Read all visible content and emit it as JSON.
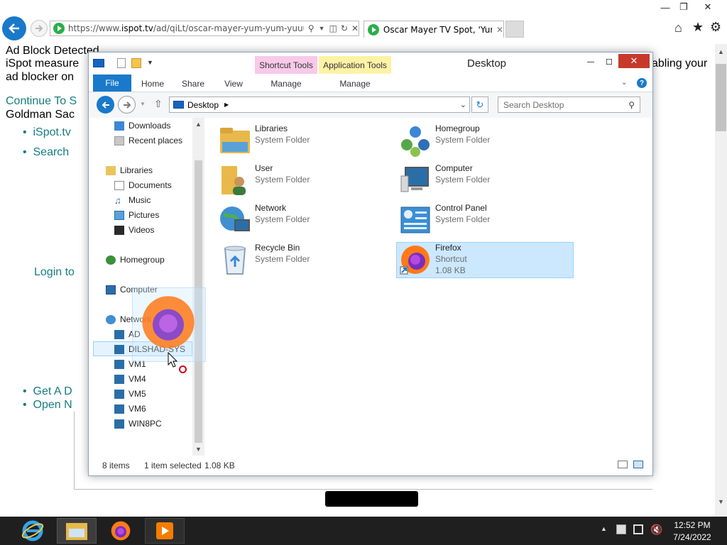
{
  "browser": {
    "url_text": "https://www.",
    "url_host": "ispot.tv",
    "url_path": "/ad/qiLt/oscar-mayer-yum-yum-yuuuum",
    "tab_title": "Oscar Mayer TV Spot, 'Yum...",
    "window_controls": [
      "minimize-icon",
      "restore-icon",
      "close-icon"
    ],
    "toolbar_icons": [
      "home-icon",
      "star-icon",
      "gear-icon"
    ]
  },
  "page": {
    "lines": [
      "Ad Block Detected",
      "iSpot measure",
      "ad blocker on",
      "abling your"
    ],
    "continue_link": "Continue To S",
    "goldman": "Goldman Sac",
    "bullets": [
      "iSpot.tv",
      "Search"
    ],
    "login": "Login to",
    "bottom_bullets": [
      "Get A D",
      "Open N"
    ]
  },
  "explorer": {
    "title": "Desktop",
    "context_tabs": {
      "shortcut": "Shortcut Tools",
      "application": "Application Tools"
    },
    "ribbon_tabs": [
      "File",
      "Home",
      "Share",
      "View",
      "Manage",
      "Manage"
    ],
    "breadcrumb": "Desktop",
    "search_placeholder": "Search Desktop",
    "nav": {
      "favorites": [
        "Downloads",
        "Recent places"
      ],
      "libraries": "Libraries",
      "library_items": [
        "Documents",
        "Music",
        "Pictures",
        "Videos"
      ],
      "homegroup": "Homegroup",
      "computer": "Computer",
      "network": "Network",
      "network_items": [
        "AD",
        "DILSHAD-SYS",
        "VM1",
        "VM4",
        "VM5",
        "VM6",
        "WIN8PC"
      ]
    },
    "items": [
      {
        "name": "Libraries",
        "type": "System Folder",
        "icon": "libraries-icon"
      },
      {
        "name": "Homegroup",
        "type": "System Folder",
        "icon": "homegroup-icon"
      },
      {
        "name": "User",
        "type": "System Folder",
        "icon": "user-folder-icon"
      },
      {
        "name": "Computer",
        "type": "System Folder",
        "icon": "computer-icon"
      },
      {
        "name": "Network",
        "type": "System Folder",
        "icon": "network-icon"
      },
      {
        "name": "Control Panel",
        "type": "System Folder",
        "icon": "control-panel-icon"
      },
      {
        "name": "Recycle Bin",
        "type": "System Folder",
        "icon": "recycle-bin-icon"
      },
      {
        "name": "Firefox",
        "type": "Shortcut",
        "size": "1.08 KB",
        "icon": "firefox-icon"
      }
    ],
    "status": {
      "count": "8 items",
      "selected": "1 item selected",
      "size": "1.08 KB"
    }
  },
  "taskbar": {
    "apps": [
      "internet-explorer-icon",
      "file-explorer-icon",
      "firefox-icon",
      "media-player-icon"
    ],
    "time": "12:52 PM",
    "date": "7/24/2022"
  },
  "colors": {
    "accent": "#1979ca",
    "selection": "#cce8ff",
    "link": "#167d7f",
    "shortcut_tab": "#f8c9e9",
    "application_tab": "#fdf2a6"
  }
}
